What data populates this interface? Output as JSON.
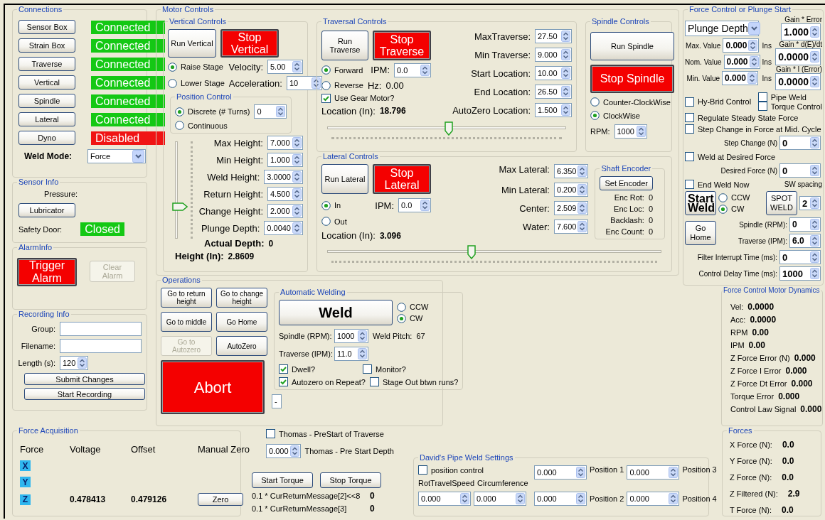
{
  "connections": {
    "title": "Connections",
    "rows": [
      [
        {
          "kind": "button",
          "label": "Sensor Box"
        },
        {
          "kind": "status",
          "label": "Connected",
          "color": "#14c814"
        }
      ],
      [
        {
          "kind": "button",
          "label": "Strain Box"
        },
        {
          "kind": "status",
          "label": "Connected",
          "color": "#14c814"
        }
      ],
      [
        {
          "kind": "button",
          "label": "Traverse"
        },
        {
          "kind": "status",
          "label": "Connected",
          "color": "#14c814"
        }
      ],
      [
        {
          "kind": "button",
          "label": "Vertical"
        },
        {
          "kind": "status",
          "label": "Connected",
          "color": "#14c814"
        }
      ],
      [
        {
          "kind": "button",
          "label": "Spindle"
        },
        {
          "kind": "status",
          "label": "Connected",
          "color": "#14c814"
        }
      ],
      [
        {
          "kind": "button",
          "label": "Lateral"
        },
        {
          "kind": "status",
          "label": "Connected",
          "color": "#14c814"
        }
      ],
      [
        {
          "kind": "button",
          "label": "Dyno"
        },
        {
          "kind": "status",
          "label": "Disabled",
          "color": "#f01414"
        }
      ],
      [
        {
          "kind": "bold_label",
          "text": "Weld Mode:"
        },
        {
          "kind": "dropdown",
          "value": "Force"
        }
      ]
    ]
  },
  "sensor_info": {
    "title": "Sensor Info",
    "rows": [
      [
        {
          "kind": "label",
          "text": "Pressure:"
        }
      ],
      [
        {
          "kind": "button",
          "label": "Lubricator"
        }
      ],
      [
        {
          "kind": "label",
          "text": "Safety Door:"
        },
        {
          "kind": "status",
          "label": "Closed",
          "color": "#14c814"
        }
      ]
    ]
  },
  "alarm_info": {
    "title": "AlarmInfo",
    "rows": [
      [
        {
          "kind": "stop_button",
          "label": "Trigger Alarm",
          "disabled": false
        },
        {
          "kind": "button",
          "label": "Clear Alarm",
          "disabled": true
        }
      ]
    ]
  },
  "recording_info": {
    "title": "Recording Info",
    "rows": [
      [
        {
          "kind": "label",
          "text": "Group:"
        },
        {
          "kind": "field"
        }
      ],
      [
        {
          "kind": "label",
          "text": "Filename:"
        },
        {
          "kind": "field"
        }
      ],
      [
        {
          "kind": "label",
          "text": "Length (s):"
        },
        {
          "kind": "spin",
          "value": "120"
        }
      ],
      [
        {
          "kind": "button",
          "label": "Submit Changes"
        }
      ],
      [
        {
          "kind": "button",
          "label": "Start Recording"
        }
      ]
    ]
  },
  "motor_controls": {
    "title": "Motor Controls",
    "vertical": {
      "title": "Vertical Controls",
      "rows": [
        [
          {
            "kind": "button",
            "label": "Run Vertical"
          },
          {
            "kind": "stop_button",
            "label": "Stop Vertical"
          }
        ],
        [
          {
            "kind": "radio",
            "label": "Raise Stage",
            "selected": true
          },
          {
            "kind": "label",
            "text": "Velocity:"
          },
          {
            "kind": "spin",
            "value": "5.00"
          }
        ],
        [
          {
            "kind": "radio",
            "label": "Lower Stage",
            "selected": false
          },
          {
            "kind": "label",
            "text": "Acceleration:"
          },
          {
            "kind": "spin",
            "value": "10"
          }
        ],
        [
          {
            "kind": "group",
            "title": "Position Control",
            "rows": [
              [
                {
                  "kind": "radio",
                  "label": "Discrete (# Turns)",
                  "selected": true
                },
                {
                  "kind": "spin",
                  "value": "0"
                }
              ],
              [
                {
                  "kind": "radio",
                  "label": "Continuous",
                  "selected": false
                }
              ]
            ]
          }
        ],
        [
          {
            "kind": "vslider",
            "level": 0.31
          },
          {
            "kind": "stack",
            "rows": [
              [
                {
                  "kind": "label",
                  "text": "Max Height:"
                },
                {
                  "kind": "spin",
                  "value": "7.000"
                }
              ],
              [
                {
                  "kind": "label",
                  "text": "Min Height:"
                },
                {
                  "kind": "spin",
                  "value": "1.000"
                }
              ],
              [
                {
                  "kind": "label",
                  "text": "Weld Height:"
                },
                {
                  "kind": "spin",
                  "value": "3.0000"
                }
              ],
              [
                {
                  "kind": "label",
                  "text": "Return Height:"
                },
                {
                  "kind": "spin",
                  "value": "4.500"
                }
              ],
              [
                {
                  "kind": "label",
                  "text": "Change Height:"
                },
                {
                  "kind": "spin",
                  "value": "2.000"
                }
              ],
              [
                {
                  "kind": "label",
                  "text": "Plunge Depth:"
                },
                {
                  "kind": "spin",
                  "value": "0.0040"
                }
              ],
              [
                {
                  "kind": "bold_label",
                  "text": "Actual Depth:"
                },
                {
                  "kind": "value",
                  "text": "0"
                }
              ]
            ]
          }
        ],
        [
          {
            "kind": "bold_label",
            "text": "Height (In):"
          },
          {
            "kind": "value",
            "text": "2.8609"
          }
        ]
      ]
    },
    "traversal": {
      "title": "Traversal Controls",
      "rows": [
        [
          {
            "kind": "stack",
            "rows": [
              [
                {
                  "kind": "button",
                  "label": "Run Traverse"
                },
                {
                  "kind": "stop_button",
                  "label": "Stop Traverse"
                }
              ],
              [
                {
                  "kind": "radio",
                  "label": "Forward",
                  "selected": true
                },
                {
                  "kind": "label",
                  "text": "IPM:"
                },
                {
                  "kind": "spin",
                  "value": "0.0"
                }
              ],
              [
                {
                  "kind": "radio",
                  "label": "Reverse",
                  "selected": false
                },
                {
                  "kind": "label",
                  "text": "Hz:"
                },
                {
                  "kind": "label",
                  "text": "0.00"
                }
              ],
              [
                {
                  "kind": "checkbox",
                  "label": "Use Gear Motor?",
                  "checked": true
                }
              ],
              [
                {
                  "kind": "label",
                  "text": "Location (In):"
                },
                {
                  "kind": "value",
                  "text": "18.796"
                }
              ]
            ]
          },
          {
            "kind": "stack",
            "rows": [
              [
                {
                  "kind": "label",
                  "text": "MaxTraverse:"
                },
                {
                  "kind": "spin",
                  "value": "27.50"
                }
              ],
              [
                {
                  "kind": "label",
                  "text": "Min Traverse:"
                },
                {
                  "kind": "spin",
                  "value": "9.000"
                }
              ],
              [
                {
                  "kind": "label",
                  "text": "Start Location:"
                },
                {
                  "kind": "spin",
                  "value": "10.00"
                }
              ],
              [
                {
                  "kind": "label",
                  "text": "End Location:"
                },
                {
                  "kind": "spin",
                  "value": "26.50"
                }
              ],
              [
                {
                  "kind": "label",
                  "text": "AutoZero Location:"
                },
                {
                  "kind": "spin",
                  "value": "1.500"
                }
              ]
            ]
          }
        ],
        [
          {
            "kind": "hslider",
            "level": 0.51
          }
        ]
      ]
    },
    "spindle": {
      "title": "Spindle Controls",
      "rows": [
        [
          {
            "kind": "button",
            "label": "Run Spindle"
          }
        ],
        [
          {
            "kind": "stop_button",
            "label": "Stop Spindle"
          }
        ],
        [
          {
            "kind": "radio",
            "label": "Counter-ClockWise",
            "selected": false
          }
        ],
        [
          {
            "kind": "radio",
            "label": "ClockWise",
            "selected": true
          }
        ],
        [
          {
            "kind": "label",
            "text": "RPM:"
          },
          {
            "kind": "spin",
            "value": "1000"
          }
        ]
      ]
    },
    "lateral": {
      "title": "Lateral Controls",
      "rows": [
        [
          {
            "kind": "stack",
            "rows": [
              [
                {
                  "kind": "button",
                  "label": "Run Lateral"
                },
                {
                  "kind": "stop_button",
                  "label": "Stop Lateral"
                }
              ],
              [
                {
                  "kind": "radio",
                  "label": "In",
                  "selected": true
                },
                {
                  "kind": "label",
                  "text": "IPM:"
                },
                {
                  "kind": "spin",
                  "value": "0.0"
                }
              ],
              [
                {
                  "kind": "radio",
                  "label": "Out",
                  "selected": false
                }
              ],
              [
                {
                  "kind": "label",
                  "text": "Location (In):"
                },
                {
                  "kind": "value",
                  "text": "3.096"
                }
              ]
            ]
          },
          {
            "kind": "stack",
            "rows": [
              [
                {
                  "kind": "label",
                  "text": "Max Lateral:"
                },
                {
                  "kind": "spin",
                  "value": "6.350"
                }
              ],
              [
                {
                  "kind": "label",
                  "text": "Min Lateral:"
                },
                {
                  "kind": "spin",
                  "value": "0.200"
                }
              ],
              [
                {
                  "kind": "label",
                  "text": "Center:"
                },
                {
                  "kind": "spin",
                  "value": "2.509"
                }
              ],
              [
                {
                  "kind": "label",
                  "text": "Water:"
                },
                {
                  "kind": "spin",
                  "value": "7.600"
                }
              ]
            ]
          },
          {
            "kind": "group",
            "title": "Shaft Encoder",
            "rows": [
              [
                {
                  "kind": "button",
                  "label": "Set Encoder"
                }
              ],
              [
                {
                  "kind": "label",
                  "text": "Enc Rot:"
                },
                {
                  "kind": "label",
                  "text": "0"
                }
              ],
              [
                {
                  "kind": "label",
                  "text": "Enc Loc:"
                },
                {
                  "kind": "label",
                  "text": "0"
                }
              ],
              [
                {
                  "kind": "label",
                  "text": "Backlash:"
                },
                {
                  "kind": "label",
                  "text": "0"
                }
              ],
              [
                {
                  "kind": "label",
                  "text": "Enc Count:"
                },
                {
                  "kind": "label",
                  "text": "0"
                }
              ]
            ]
          }
        ],
        [
          {
            "kind": "hslider",
            "level": 0.43
          }
        ]
      ]
    }
  },
  "force_control": {
    "title": "Force Control or Plunge Start",
    "rows": [
      [
        {
          "kind": "stack",
          "rows": [
            [
              {
                "kind": "dropdown",
                "value": "Plunge Depth"
              }
            ],
            [
              {
                "kind": "label",
                "text": "Max. Value"
              },
              {
                "kind": "spin",
                "value": "0.000"
              },
              {
                "kind": "label",
                "text": "Ins"
              }
            ],
            [
              {
                "kind": "label",
                "text": "Nom. Value"
              },
              {
                "kind": "spin",
                "value": "0.000"
              },
              {
                "kind": "label",
                "text": "Ins"
              }
            ],
            [
              {
                "kind": "label",
                "text": "Min. Value"
              },
              {
                "kind": "spin",
                "value": "0.000"
              },
              {
                "kind": "label",
                "text": "Ins"
              }
            ]
          ]
        },
        {
          "kind": "stack",
          "rows": [
            [
              {
                "kind": "label",
                "text": "Gain * Error"
              }
            ],
            [
              {
                "kind": "spin_large",
                "value": "1.000"
              }
            ],
            [
              {
                "kind": "label",
                "text": "Gain * d(E)/dt"
              }
            ],
            [
              {
                "kind": "spin_large",
                "value": "0.0000"
              }
            ],
            [
              {
                "kind": "label",
                "text": "Gain * I (Error)"
              }
            ],
            [
              {
                "kind": "spin_large",
                "value": "0.0000"
              }
            ]
          ]
        }
      ],
      [
        {
          "kind": "checkbox",
          "label": "Hy-Brid Control",
          "checked": false
        },
        {
          "kind": "stack",
          "rows": [
            [
              {
                "kind": "checkbox",
                "label": "Pipe Weld",
                "checked": false
              }
            ],
            [
              {
                "kind": "checkbox",
                "label": "Torque Control",
                "checked": false
              }
            ]
          ]
        }
      ],
      [
        {
          "kind": "checkbox",
          "label": "Regulate Steady State Force",
          "checked": false
        }
      ],
      [
        {
          "kind": "checkbox",
          "label": "Step Change in Force at Mid. Cycle",
          "checked": false
        }
      ],
      [
        {
          "kind": "label",
          "text": "Step Change (N)"
        },
        {
          "kind": "spin",
          "value": "0"
        }
      ],
      [
        {
          "kind": "checkbox",
          "label": "Weld at Desired Force",
          "checked": false
        }
      ],
      [
        {
          "kind": "label",
          "text": "Desired Force (N)"
        },
        {
          "kind": "spin",
          "value": "0"
        }
      ],
      [
        {
          "kind": "checkbox",
          "label": "End Weld Now",
          "checked": false
        },
        {
          "kind": "label",
          "text": "SW spacing"
        }
      ],
      [
        {
          "kind": "weld_button",
          "label": "Start Weld"
        },
        {
          "kind": "stack",
          "rows": [
            [
              {
                "kind": "radio",
                "label": "CCW",
                "selected": false
              }
            ],
            [
              {
                "kind": "radio",
                "label": "CW",
                "selected": true
              }
            ]
          ]
        },
        {
          "kind": "button",
          "label": "SPOT WELD"
        },
        {
          "kind": "spin",
          "value": "2"
        }
      ],
      [
        {
          "kind": "button",
          "label": "Go Home"
        },
        {
          "kind": "stack",
          "rows": [
            [
              {
                "kind": "label",
                "text": "Spindle (RPM):"
              },
              {
                "kind": "spin",
                "value": "0"
              }
            ],
            [
              {
                "kind": "label",
                "text": "Traverse (IPM):"
              },
              {
                "kind": "spin",
                "value": "6.0"
              }
            ]
          ]
        }
      ],
      [
        {
          "kind": "label",
          "text": "Filter Interrupt Time (ms):"
        },
        {
          "kind": "spin",
          "value": "0"
        }
      ],
      [
        {
          "kind": "label",
          "text": "Control Delay Time (ms):"
        },
        {
          "kind": "spin",
          "value": "1000"
        }
      ]
    ]
  },
  "operations": {
    "title": "Operations",
    "rows": [
      [
        {
          "kind": "stack",
          "rows": [
            [
              {
                "kind": "button",
                "label": "Go to return height",
                "disabled": false
              },
              {
                "kind": "button",
                "label": "Go to change height",
                "disabled": false
              }
            ],
            [
              {
                "kind": "button",
                "label": "Go to middle",
                "disabled": false
              },
              {
                "kind": "button",
                "label": "Go Home",
                "disabled": false
              }
            ],
            [
              {
                "kind": "button",
                "label": "Go to Autozero",
                "disabled": true
              },
              {
                "kind": "button",
                "label": "AutoZero",
                "disabled": false
              }
            ],
            [
              {
                "kind": "stop_button",
                "label": "Abort",
                "disabled": false
              }
            ]
          ]
        },
        {
          "kind": "stack",
          "rows": [
            [
              {
                "kind": "group",
                "title": "Automatic Welding",
                "rows": [
                  [
                    {
                      "kind": "weld_button",
                      "label": "Weld"
                    },
                    {
                      "kind": "stack",
                      "rows": [
                        [
                          {
                            "kind": "radio",
                            "label": "CCW",
                            "selected": false
                          }
                        ],
                        [
                          {
                            "kind": "radio",
                            "label": "CW",
                            "selected": true
                          }
                        ]
                      ]
                    }
                  ],
                  [
                    {
                      "kind": "label",
                      "text": "Spindle (RPM):"
                    },
                    {
                      "kind": "spin",
                      "value": "1000"
                    },
                    {
                      "kind": "label",
                      "text": "Weld Pitch:"
                    },
                    {
                      "kind": "label",
                      "text": "67"
                    }
                  ],
                  [
                    {
                      "kind": "label",
                      "text": "Traverse (IPM):"
                    },
                    {
                      "kind": "spin",
                      "value": "11.0"
                    }
                  ],
                  [
                    {
                      "kind": "checkbox",
                      "label": "Dwell?",
                      "checked": true
                    },
                    {
                      "kind": "checkbox",
                      "label": "Monitor?",
                      "checked": false
                    }
                  ],
                  [
                    {
                      "kind": "checkbox",
                      "label": "Autozero on Repeat?",
                      "checked": true
                    },
                    {
                      "kind": "checkbox",
                      "label": "Stage Out btwn runs?",
                      "checked": false
                    }
                  ]
                ]
              }
            ],
            [
              {
                "kind": "mini_field",
                "value": "-"
              }
            ]
          ]
        }
      ]
    ]
  },
  "force_acquisition": {
    "title": "Force Acquisition",
    "rows": [
      [
        {
          "kind": "label",
          "text": "Force"
        },
        {
          "kind": "label",
          "text": "Voltage"
        },
        {
          "kind": "label",
          "text": "Offset"
        },
        {
          "kind": "label",
          "text": "Manual Zero"
        }
      ],
      [
        {
          "kind": "tag",
          "text": "X"
        }
      ],
      [
        {
          "kind": "tag",
          "text": "Y"
        }
      ],
      [
        {
          "kind": "tag",
          "text": "Z"
        },
        {
          "kind": "value",
          "text": "0.478413"
        },
        {
          "kind": "value",
          "text": "0.479126"
        },
        {
          "kind": "button",
          "label": "Zero"
        }
      ]
    ]
  },
  "thomas": {
    "rows": [
      [
        {
          "kind": "checkbox",
          "label": "Thomas - PreStart of Traverse",
          "checked": false
        }
      ],
      [
        {
          "kind": "spin",
          "value": "0.000"
        },
        {
          "kind": "label",
          "text": "Thomas - Pre Start Depth"
        }
      ],
      [
        {
          "kind": "button",
          "label": "Start Torque"
        },
        {
          "kind": "button",
          "label": "Stop Torque"
        }
      ],
      [
        {
          "kind": "label",
          "text": "0.1 * CurReturnMessage[2]<<8"
        },
        {
          "kind": "value",
          "text": "0"
        }
      ],
      [
        {
          "kind": "label",
          "text": "0.1 * CurReturnMessage[3]"
        },
        {
          "kind": "value",
          "text": "0"
        }
      ]
    ]
  },
  "davids_pipe_weld": {
    "title": "David's Pipe Weld Settings",
    "rows": [
      [
        {
          "kind": "stack",
          "rows": [
            [
              {
                "kind": "checkbox",
                "label": "position control",
                "checked": false
              }
            ],
            [
              {
                "kind": "label",
                "text": "RotTravelSpeed"
              },
              {
                "kind": "label",
                "text": "Circumference"
              }
            ],
            [
              {
                "kind": "spin",
                "value": "0.000"
              },
              {
                "kind": "spin",
                "value": "0.000"
              }
            ]
          ]
        },
        {
          "kind": "stack",
          "rows": [
            [
              {
                "kind": "spin",
                "value": "0.000"
              },
              {
                "kind": "label",
                "text": "Position 1"
              },
              {
                "kind": "spin",
                "value": "0.000"
              },
              {
                "kind": "label",
                "text": "Position 3"
              }
            ],
            [
              {
                "kind": "spin",
                "value": "0.000"
              },
              {
                "kind": "label",
                "text": "Position 2"
              },
              {
                "kind": "spin",
                "value": "0.000"
              },
              {
                "kind": "label",
                "text": "Position 4"
              }
            ]
          ]
        }
      ]
    ]
  },
  "motor_dynamics": {
    "title": "Force Control Motor Dynamics",
    "rows": [
      [
        {
          "kind": "label",
          "text": "Vel:"
        },
        {
          "kind": "value",
          "text": "0.0000"
        }
      ],
      [
        {
          "kind": "label",
          "text": "Acc:"
        },
        {
          "kind": "value",
          "text": "0.0000"
        }
      ],
      [
        {
          "kind": "label",
          "text": "RPM"
        },
        {
          "kind": "value",
          "text": "0.00"
        }
      ],
      [
        {
          "kind": "label",
          "text": "IPM"
        },
        {
          "kind": "value",
          "text": "0.00"
        }
      ],
      [
        {
          "kind": "label",
          "text": "Z Force Error (N)"
        },
        {
          "kind": "value",
          "text": "0.000"
        }
      ],
      [
        {
          "kind": "label",
          "text": "Z Force I Error"
        },
        {
          "kind": "value",
          "text": "0.000"
        }
      ],
      [
        {
          "kind": "label",
          "text": "Z Force Dt Error"
        },
        {
          "kind": "value",
          "text": "0.000"
        }
      ],
      [
        {
          "kind": "label",
          "text": "Torque Error"
        },
        {
          "kind": "value",
          "text": "0.000"
        }
      ],
      [
        {
          "kind": "label",
          "text": "Control Law Signal"
        },
        {
          "kind": "value",
          "text": "0.000"
        }
      ]
    ]
  },
  "forces": {
    "title": "Forces",
    "rows": [
      [
        {
          "kind": "label",
          "text": "X Force (N):"
        },
        {
          "kind": "value",
          "text": "0.0"
        }
      ],
      [
        {
          "kind": "label",
          "text": "Y Force (N):"
        },
        {
          "kind": "value",
          "text": "0.0"
        }
      ],
      [
        {
          "kind": "label",
          "text": "Z Force (N):"
        },
        {
          "kind": "value",
          "text": "0.0"
        }
      ],
      [
        {
          "kind": "label",
          "text": "Z Filtered (N):"
        },
        {
          "kind": "value",
          "text": "2.9"
        }
      ],
      [
        {
          "kind": "label",
          "text": "T Force (N):"
        },
        {
          "kind": "value",
          "text": "0.0"
        }
      ]
    ]
  }
}
